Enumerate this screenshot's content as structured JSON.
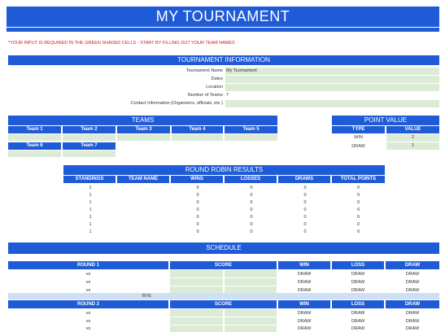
{
  "title": "MY TOURNAMENT",
  "instruction": "*YOUR INPUT IS REQUIRED IN THE GREEN SHADED CELLS - START BY FILLING OUT YOUR TEAM NAMES",
  "info": {
    "header": "TOURNAMENT INFORMATION",
    "rows": [
      {
        "label": "Tournament Name",
        "value": "My Tournament"
      },
      {
        "label": "Dates",
        "value": ""
      },
      {
        "label": "Location",
        "value": ""
      },
      {
        "label": "Number of Teams",
        "value": "7"
      },
      {
        "label": "Contact Information (Organizers, officials, etc.)",
        "value": ""
      }
    ]
  },
  "teams": {
    "header": "TEAMS",
    "row1": [
      "Team 1",
      "Team 2",
      "Team 3",
      "Team 4",
      "Team 5"
    ],
    "row2": [
      "Team 6",
      "Team 7"
    ]
  },
  "points": {
    "header": "POINT VALUE",
    "col_type": "TYPE",
    "col_value": "VALUE",
    "rows": [
      {
        "type": "WIN",
        "value": "2"
      },
      {
        "type": "DRAW",
        "value": "1"
      }
    ]
  },
  "round_robin": {
    "header": "ROUND ROBIN RESULTS",
    "columns": [
      "STANDINGS",
      "TEAM NAME",
      "WINS",
      "LOSSES",
      "DRAWS",
      "TOTAL POINTS"
    ],
    "rows": [
      [
        "1",
        "",
        "0",
        "0",
        "0",
        "0"
      ],
      [
        "1",
        "",
        "0",
        "0",
        "0",
        "0"
      ],
      [
        "1",
        "",
        "0",
        "0",
        "0",
        "0"
      ],
      [
        "1",
        "",
        "0",
        "0",
        "0",
        "0"
      ],
      [
        "1",
        "",
        "0",
        "0",
        "0",
        "0"
      ],
      [
        "1",
        "",
        "0",
        "0",
        "0",
        "0"
      ],
      [
        "1",
        "",
        "0",
        "0",
        "0",
        "0"
      ]
    ]
  },
  "schedule": {
    "header": "SCHEDULE",
    "round1": {
      "label": "ROUND 1",
      "score": "SCORE",
      "win": "WIN",
      "loss": "LOSS",
      "draw": "DRAW",
      "rows": [
        {
          "vs": "vs",
          "win": "DRAW",
          "loss": "DRAW",
          "draw": "DRAW"
        },
        {
          "vs": "vs",
          "win": "DRAW",
          "loss": "DRAW",
          "draw": "DRAW"
        },
        {
          "vs": "vs",
          "win": "DRAW",
          "loss": "DRAW",
          "draw": "DRAW"
        }
      ],
      "bye": "BYE"
    },
    "round2": {
      "label": "ROUND 2",
      "score": "SCORE",
      "win": "WIN",
      "loss": "LOSS",
      "draw": "DRAW",
      "rows": [
        {
          "vs": "vs",
          "win": "DRAW",
          "loss": "DRAW",
          "draw": "DRAW"
        },
        {
          "vs": "vs",
          "win": "DRAW",
          "loss": "DRAW",
          "draw": "DRAW"
        },
        {
          "vs": "vs",
          "win": "DRAW",
          "loss": "DRAW",
          "draw": "DRAW"
        }
      ]
    }
  },
  "colors": {
    "accent": "#1f5bd6",
    "input": "#dcebd5",
    "bye": "#cfdff5",
    "note": "#d11a1a"
  }
}
